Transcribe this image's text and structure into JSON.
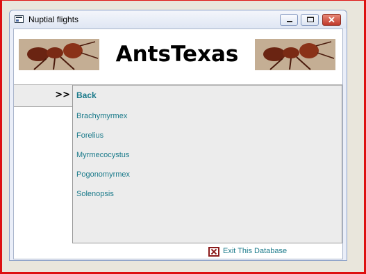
{
  "window": {
    "title": "Nuptial flights",
    "controls": [
      "minimize",
      "maximize",
      "close"
    ],
    "close_glyph": "✕"
  },
  "banner": {
    "title": "AntsTexas",
    "left_image": "ant-photo",
    "right_image": "ant-photo"
  },
  "selector": {
    "mark": ">>"
  },
  "menu": {
    "back_label": "Back",
    "items": [
      {
        "label": "Brachymyrmex"
      },
      {
        "label": "Forelius"
      },
      {
        "label": "Myrmecocystus"
      },
      {
        "label": "Pogonomyrmex"
      },
      {
        "label": "Solenopsis"
      }
    ]
  },
  "footer": {
    "exit_label": "Exit This Database"
  },
  "colors": {
    "link": "#1a7a8a",
    "frame": "#dd1111",
    "exit_icon": "#8b1a1a"
  }
}
